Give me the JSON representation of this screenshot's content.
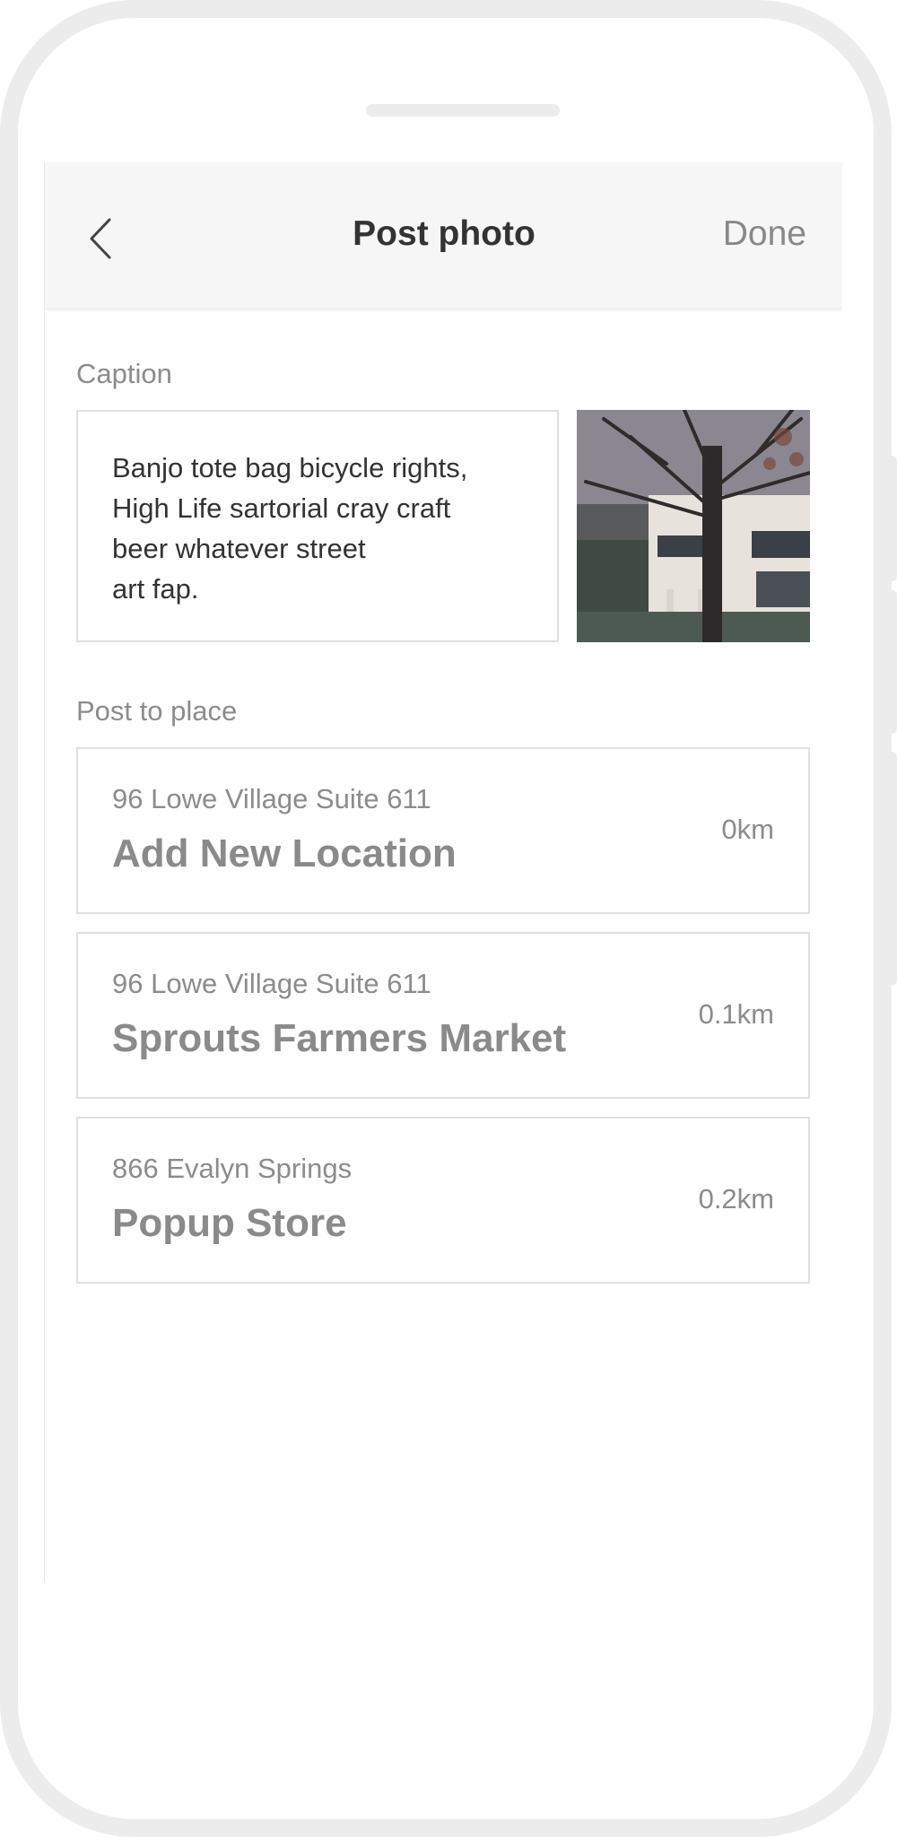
{
  "header": {
    "title": "Post photo",
    "done_label": "Done",
    "back_icon": "chevron-left-icon"
  },
  "caption": {
    "label": "Caption",
    "text": "Banjo tote bag bicycle rights,\nHigh Life sartorial cray craft\nbeer whatever street\nart fap."
  },
  "places": {
    "label": "Post to place",
    "items": [
      {
        "address": "96 Lowe Village Suite 611",
        "name": "Add New Location",
        "distance": "0km"
      },
      {
        "address": "96 Lowe Village Suite 611",
        "name": "Sprouts Farmers Market",
        "distance": "0.1km"
      },
      {
        "address": "866 Evalyn Springs",
        "name": "Popup Store",
        "distance": "0.2km"
      }
    ]
  },
  "colors": {
    "frame": "#ececec",
    "navbar_bg": "#f6f6f6",
    "title_text": "#333333",
    "muted_text": "#8c8c8c",
    "border": "#e0e0e0"
  }
}
